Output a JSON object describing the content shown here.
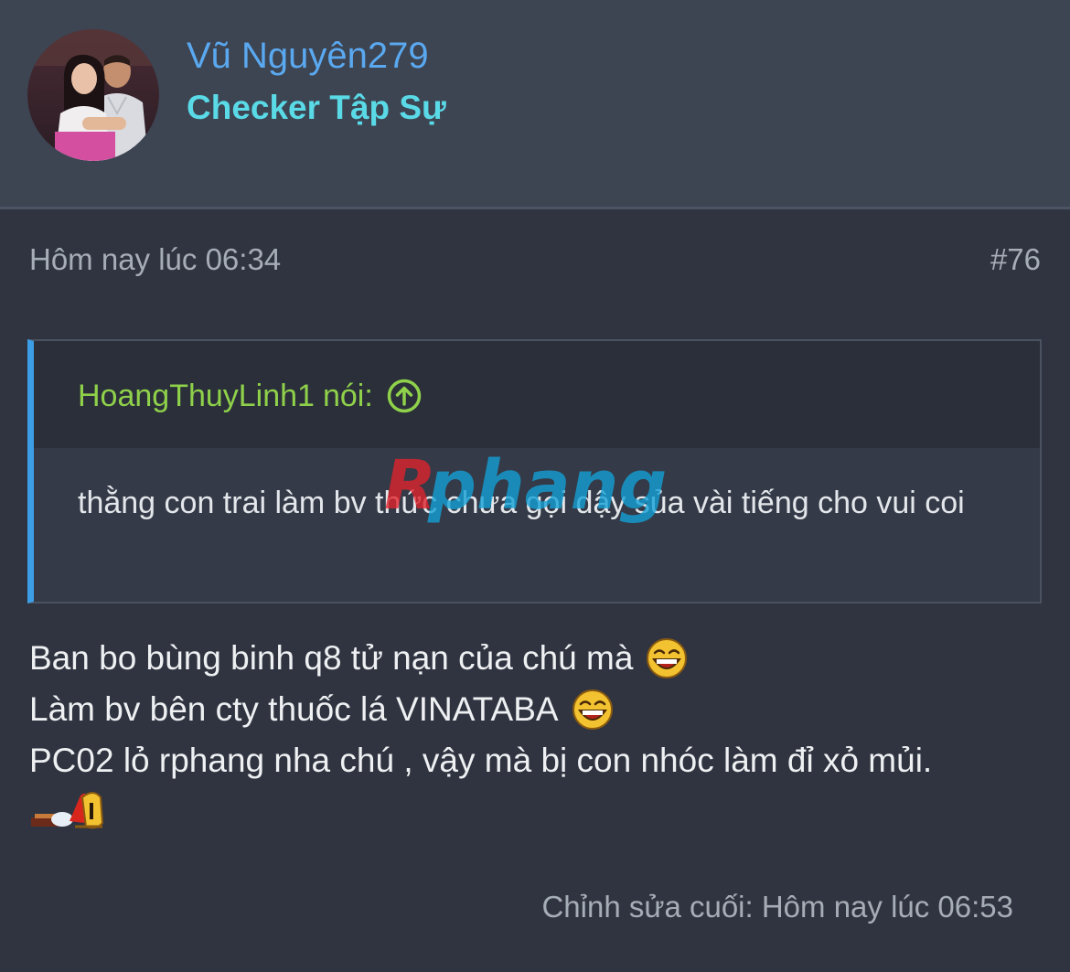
{
  "user": {
    "name": "Vũ Nguyên279",
    "title": "Checker Tập Sự",
    "avatar_icon": "user-avatar-photo"
  },
  "post": {
    "date": "Hôm nay lúc 06:34",
    "number": "#76",
    "quote": {
      "author": "HoangThuyLinh1",
      "said": "nói:",
      "jump_icon": "arrow-up-circle-icon",
      "body": "thằng con trai làm bv thức chưa gọi dậy sủa vài tiếng cho vui coi"
    },
    "lines": [
      "Ban bo bùng binh q8 tử nạn của chú mà",
      "Làm bv bên cty thuốc lá VINATABA",
      "PC02 lỏ rphang nha chú , vậy mà bị con nhóc làm đỉ xỏ mủi."
    ],
    "last_edit": "Chỉnh sửa cuối: Hôm nay lúc 06:53"
  },
  "watermark": {
    "text": "Rphang"
  },
  "colors": {
    "background": "#2f3440",
    "header": "#3d4452",
    "username": "#5aa8ef",
    "user_title": "#5ad9e6",
    "quote_author": "#8fd14a",
    "quote_border": "#3c9ee6"
  }
}
